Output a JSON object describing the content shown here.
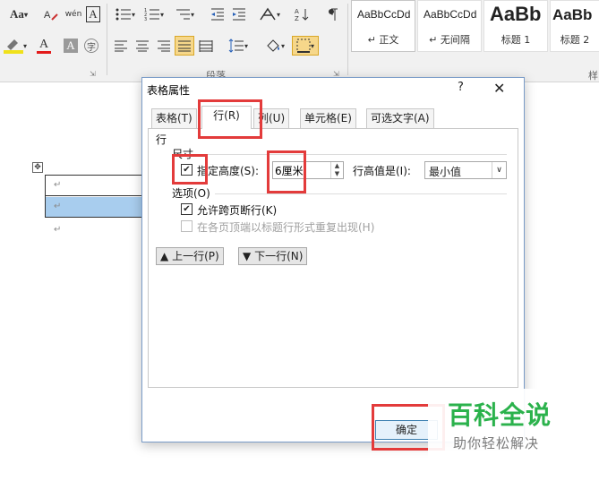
{
  "ribbon": {
    "font_group": {
      "change_case": "Aa",
      "phonetic_guide": "wén",
      "enclose_char": "A",
      "font_color_letter": "A",
      "char_shading_letter": "A",
      "enclose_symbol": "字"
    },
    "paragraph_group": {
      "label": "段落"
    },
    "styles": [
      {
        "sample": "AaBbCcDd",
        "name": "正文"
      },
      {
        "sample": "AaBbCcDd",
        "name": "无间隔"
      },
      {
        "sample": "AaBb",
        "name": "标题 1"
      },
      {
        "sample": "AaBb",
        "name": "标题 2"
      }
    ],
    "styles_group_label_partial": "样"
  },
  "dialog": {
    "title": "表格属性",
    "help": "?",
    "close": "✕",
    "tabs": [
      "表格(T)",
      "行(R)",
      "列(U)",
      "单元格(E)",
      "可选文字(A)"
    ],
    "active_tab_index": 1,
    "row_heading": "行",
    "size_label": "尺寸",
    "specify_height_label": "指定高度(S):",
    "specify_height_checked": true,
    "height_value": "6厘米",
    "row_height_is_label": "行高值是(I):",
    "row_height_mode": "最小值",
    "options_label": "选项(O)",
    "allow_break_label": "允许跨页断行(K)",
    "allow_break_checked": true,
    "repeat_header_label": "在各页顶端以标题行形式重复出现(H)",
    "repeat_header_checked": false,
    "prev_row": "上一行(P)",
    "next_row": "下一行(N)",
    "ok_label": "确定"
  },
  "watermark": {
    "line1": "百科全说",
    "line2": "助你轻松解决"
  }
}
